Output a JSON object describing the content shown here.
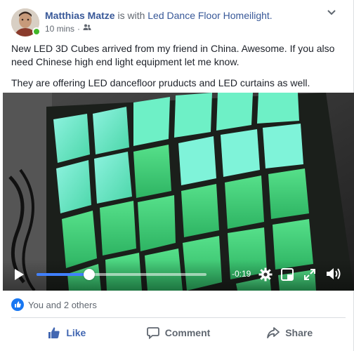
{
  "post": {
    "author_name": "Matthias Matze",
    "with_text": " is with ",
    "tagged_page": "Led Dance Floor Homeilight.",
    "timestamp": "10 mins",
    "separator": "·",
    "audience_icon": "friends-icon",
    "text_paragraphs": [
      "New LED 3D Cubes arrived from my friend in China. Awesome. If you also need Chinese high end light equipment let me know.",
      "They are offering LED dancefloor pruducts and LED curtains as well."
    ]
  },
  "video": {
    "remaining_time": "-0:19",
    "progress_fraction": 0.31,
    "led_colors": {
      "cyan": "#5ee6c8",
      "green": "#3fdc78",
      "deep_green": "#2cb861"
    }
  },
  "reactions": {
    "summary": "You and 2 others",
    "icon": "like-icon"
  },
  "actions": {
    "like": "Like",
    "comment": "Comment",
    "share": "Share"
  },
  "colors": {
    "brand": "#4267b2",
    "link": "#385898",
    "online": "#42b72a"
  }
}
